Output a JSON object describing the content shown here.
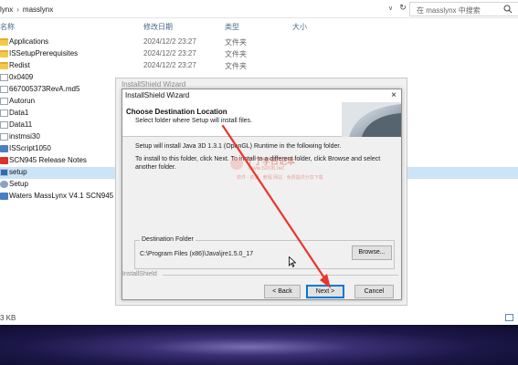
{
  "explorer": {
    "breadcrumb": [
      "lynx",
      "masslynx"
    ],
    "search": {
      "placeholder": "在 masslynx 中搜索"
    },
    "columns": {
      "name": "名称",
      "date": "修改日期",
      "type": "类型",
      "size": "大小"
    },
    "files": [
      {
        "name": "Applications",
        "date": "2024/12/2 23:27",
        "type": "文件夹",
        "icon": "folder-icon"
      },
      {
        "name": "ISSetupPrerequisites",
        "date": "2024/12/2 23:27",
        "type": "文件夹",
        "icon": "folder-icon"
      },
      {
        "name": "Redist",
        "date": "2024/12/2 23:27",
        "type": "文件夹",
        "icon": "folder-icon"
      },
      {
        "name": "0x0409",
        "date": "",
        "type": "",
        "icon": "file-icon"
      },
      {
        "name": "667005373RevA.md5",
        "date": "",
        "type": "",
        "icon": "file-icon"
      },
      {
        "name": "Autorun",
        "date": "",
        "type": "",
        "icon": "file-icon"
      },
      {
        "name": "Data1",
        "date": "",
        "type": "",
        "icon": "file-icon"
      },
      {
        "name": "Data11",
        "date": "",
        "type": "",
        "icon": "file-icon"
      },
      {
        "name": "instmsi30",
        "date": "",
        "type": "",
        "icon": "file-icon"
      },
      {
        "name": "ISScript1050",
        "date": "",
        "type": "",
        "icon": "app-icon"
      },
      {
        "name": "SCN945 Release Notes",
        "date": "",
        "type": "",
        "icon": "pdf-icon"
      },
      {
        "name": "setup",
        "date": "",
        "type": "",
        "icon": "setup-icon",
        "selected": true
      },
      {
        "name": "Setup",
        "date": "",
        "type": "",
        "icon": "settings-file-icon"
      },
      {
        "name": "Waters MassLynx V4.1 SCN945",
        "date": "",
        "type": "",
        "icon": "app-icon"
      }
    ],
    "status": {
      "size": "3 KB"
    }
  },
  "background_wizard": {
    "title": "InstallShield Wizard"
  },
  "dialog": {
    "title": "InstallShield Wizard",
    "close": "×",
    "heading": "Choose Destination Location",
    "subheading": "Select folder where Setup will install files.",
    "body1": "Setup will install Java 3D 1.3.1 (OpenGL) Runtime in the following folder.",
    "body2": "To install to this folder, click Next. To install to a different folder, click Browse and select another folder.",
    "destination": {
      "legend": "Destination Folder",
      "path": "C:\\Program Files (x86)\\Java\\jre1.5.0_17",
      "browse": "Browse..."
    },
    "brand_label": "InstallShield",
    "buttons": {
      "back": "< Back",
      "next": "Next >",
      "cancel": "Cancel"
    }
  },
  "watermark": {
    "title": "丁丁学日记本",
    "url": "www.ts008.net",
    "line": "软件 · 资源 · 教程 网站 · 免费提供分享下载"
  },
  "colors": {
    "selection": "#cce4f7",
    "annotation_arrow": "#e8362a",
    "default_button_border": "#0078d7"
  }
}
